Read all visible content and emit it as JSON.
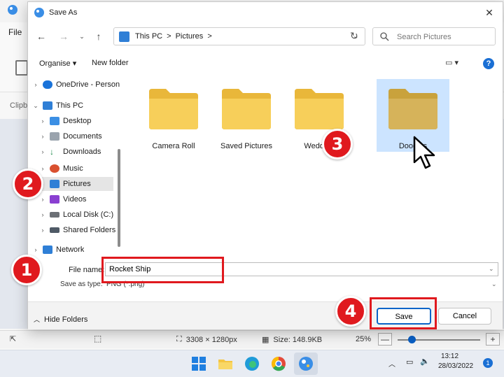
{
  "background_app": {
    "ribbon_file": "File",
    "ribbon_clipboard": "Clipb",
    "status_dimensions": "3308 × 1280px",
    "status_size": "Size: 148.9KB",
    "status_zoom": "25%"
  },
  "taskbar": {
    "apps": [
      "windows-start-icon",
      "file-explorer-icon",
      "edge-icon",
      "chrome-icon",
      "paint-icon"
    ],
    "time": "13:12",
    "date": "28/03/2022",
    "notifications": "1"
  },
  "dialog": {
    "title": "Save As",
    "close_glyph": "✕",
    "breadcrumbs": [
      "This PC",
      ">",
      "Pictures",
      ">"
    ],
    "search_placeholder": "Search Pictures",
    "organise_label": "Organise ▾",
    "new_folder_label": "New folder",
    "help_glyph": "?",
    "nav_items": [
      {
        "label": "OneDrive - Person",
        "icon": "cloud-icon"
      },
      {
        "label": "This PC",
        "icon": "computer-icon"
      },
      {
        "label": "Desktop",
        "icon": "desktop-icon"
      },
      {
        "label": "Documents",
        "icon": "documents-icon"
      },
      {
        "label": "Downloads",
        "icon": "downloads-icon"
      },
      {
        "label": "Music",
        "icon": "music-icon"
      },
      {
        "label": "Pictures",
        "icon": "pictures-icon"
      },
      {
        "label": "Videos",
        "icon": "videos-icon"
      },
      {
        "label": "Local Disk (C:)",
        "icon": "disk-icon"
      },
      {
        "label": "Shared Folders (",
        "icon": "shared-icon"
      },
      {
        "label": "Network",
        "icon": "network-icon"
      }
    ],
    "folders": [
      "Camera Roll",
      "Saved Pictures",
      "Wedding",
      "Doodles"
    ],
    "file_name_label": "File name:",
    "file_name_value": "Rocket Ship",
    "save_as_type_label": "Save as type:",
    "save_as_type_value": "PNG (*.png)",
    "hide_folders_label": "Hide Folders",
    "save_label": "Save",
    "cancel_label": "Cancel"
  },
  "annotations": [
    "1",
    "2",
    "3",
    "4"
  ],
  "colors": {
    "annotation_red": "#e0191e",
    "selection_blue": "#cce4ff",
    "primary_blue": "#0a64c8",
    "folder_yellow": "#f7cf5a"
  }
}
